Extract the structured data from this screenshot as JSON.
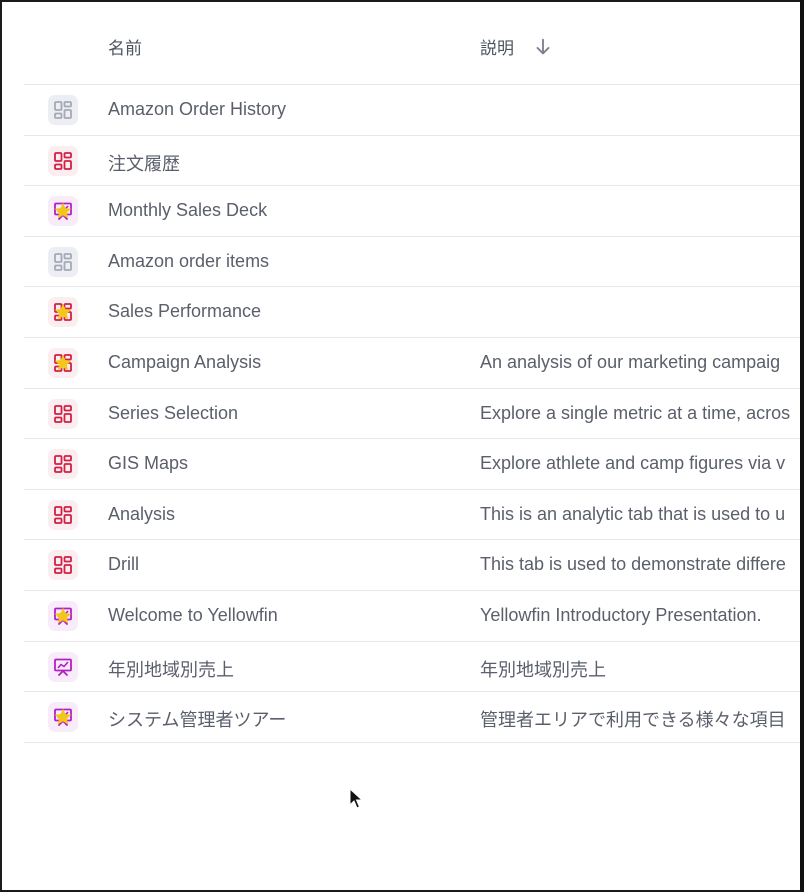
{
  "header": {
    "name_label": "名前",
    "description_label": "説明",
    "sort_icon": "arrow-down-icon"
  },
  "colors": {
    "dashboard_active": "#d11f45",
    "dashboard_inactive": "#a4a9b6",
    "story": "#b41fc4",
    "favorite_star": "#f5c518"
  },
  "rows": [
    {
      "name": "Amazon Order History",
      "description": "",
      "type": "dashboard-inactive",
      "favorite": false
    },
    {
      "name": "注文履歴",
      "description": "",
      "type": "dashboard",
      "favorite": false
    },
    {
      "name": "Monthly Sales Deck",
      "description": "",
      "type": "story",
      "favorite": true
    },
    {
      "name": "Amazon order items",
      "description": "",
      "type": "dashboard-inactive",
      "favorite": false
    },
    {
      "name": "Sales Performance",
      "description": "",
      "type": "dashboard",
      "favorite": true
    },
    {
      "name": "Campaign Analysis",
      "description": "An analysis of our marketing campaig",
      "type": "dashboard",
      "favorite": true
    },
    {
      "name": "Series Selection",
      "description": "Explore a single metric at a time, acros",
      "type": "dashboard",
      "favorite": false
    },
    {
      "name": "GIS Maps",
      "description": "Explore athlete and camp figures via v",
      "type": "dashboard",
      "favorite": false
    },
    {
      "name": "Analysis",
      "description": "This is an analytic tab that is used to u",
      "type": "dashboard",
      "favorite": false
    },
    {
      "name": "Drill",
      "description": "This tab is used to demonstrate differe",
      "type": "dashboard",
      "favorite": false
    },
    {
      "name": "Welcome to Yellowfin",
      "description": "Yellowfin Introductory Presentation.",
      "type": "story",
      "favorite": true
    },
    {
      "name": "年別地域別売上",
      "description": "年別地域別売上",
      "type": "story",
      "favorite": false
    },
    {
      "name": "システム管理者ツアー",
      "description": "管理者エリアで利用できる様々な項目",
      "type": "story",
      "favorite": true
    }
  ]
}
